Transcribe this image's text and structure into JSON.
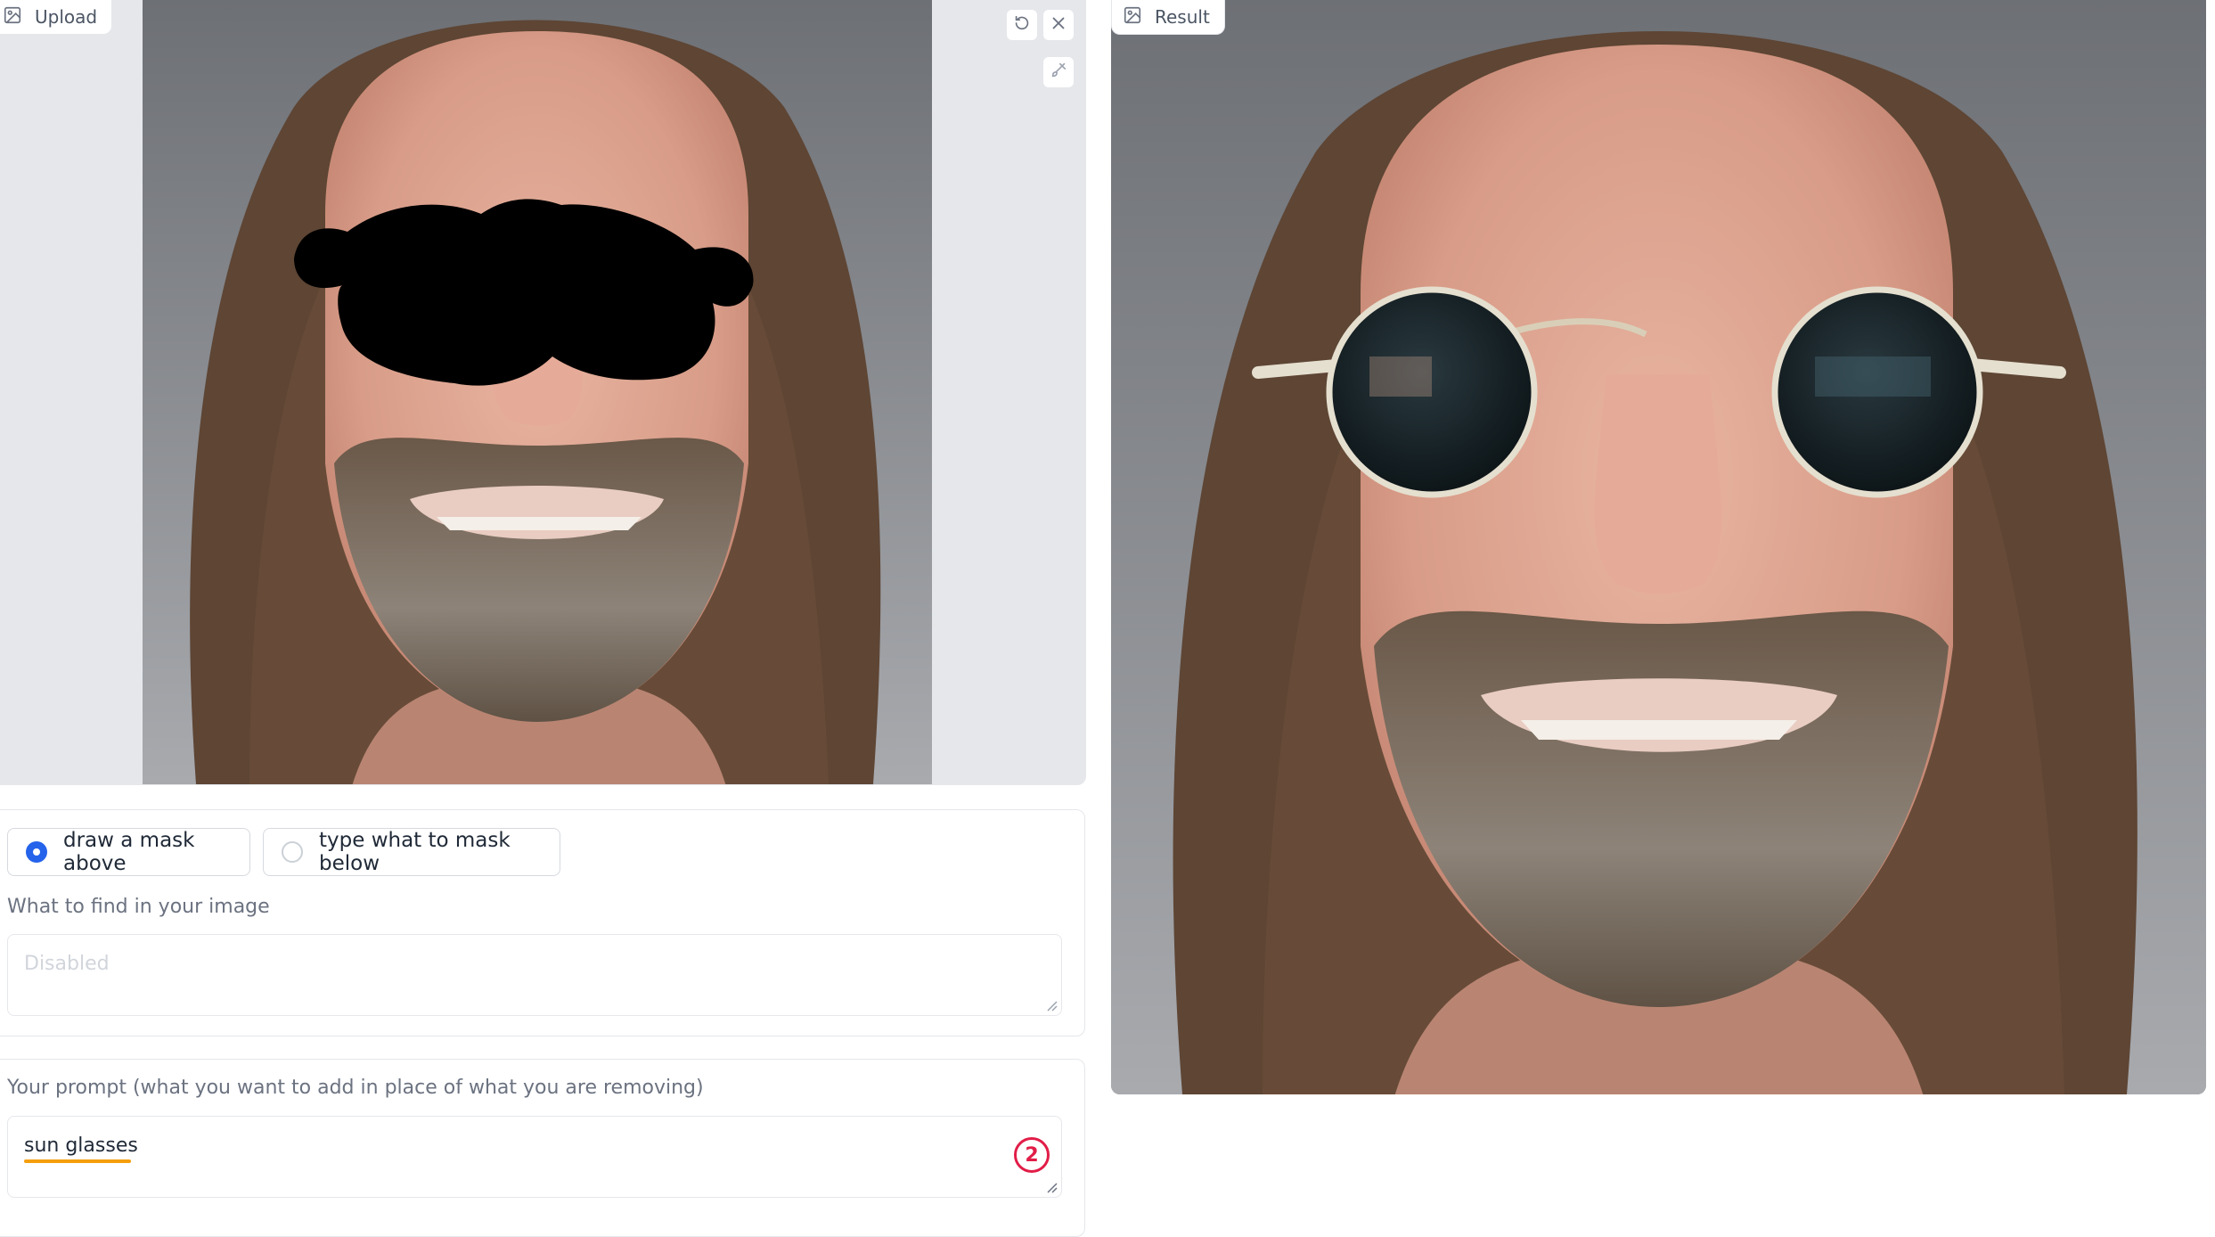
{
  "upload": {
    "tag_label": "Upload",
    "icons": [
      "image-icon",
      "undo-icon",
      "close-icon",
      "brush-icon"
    ]
  },
  "result": {
    "tag_label": "Result",
    "icons": [
      "image-icon"
    ]
  },
  "mask_options": {
    "options": [
      {
        "label": "draw a mask above",
        "selected": true
      },
      {
        "label": "type what to mask below",
        "selected": false
      }
    ]
  },
  "find": {
    "label": "What to find in your image",
    "placeholder": "Disabled",
    "value": ""
  },
  "prompt": {
    "label": "Your prompt (what you want to add in place of what you are removing)",
    "value": "sun glasses",
    "badge": "2"
  },
  "colors": {
    "accent": "#2563eb",
    "badge": "#e11d48",
    "spellcheck": "#f59e0b"
  }
}
